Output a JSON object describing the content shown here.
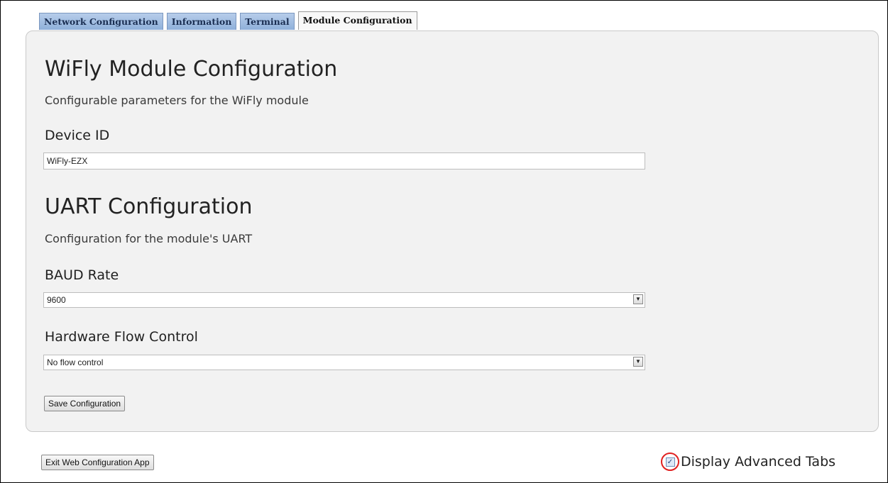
{
  "tabs": [
    {
      "label": "Network Configuration",
      "active": false
    },
    {
      "label": "Information",
      "active": false
    },
    {
      "label": "Terminal",
      "active": false
    },
    {
      "label": "Module Configuration",
      "active": true
    }
  ],
  "module": {
    "title": "WiFly Module Configuration",
    "description": "Configurable parameters for the WiFly module",
    "device_id_label": "Device ID",
    "device_id_value": "WiFly-EZX"
  },
  "uart": {
    "title": "UART Configuration",
    "description": "Configuration for the module's UART",
    "baud_label": "BAUD Rate",
    "baud_value": "9600",
    "flow_label": "Hardware Flow Control",
    "flow_value": "No flow control"
  },
  "buttons": {
    "save": "Save Configuration",
    "exit": "Exit Web Configuration App"
  },
  "advanced": {
    "label": "Display Advanced Tabs",
    "checked": true,
    "highlight_color": "#e02020"
  },
  "colors": {
    "tab_blue": "#8fb0da",
    "panel": "#f2f2f2"
  }
}
